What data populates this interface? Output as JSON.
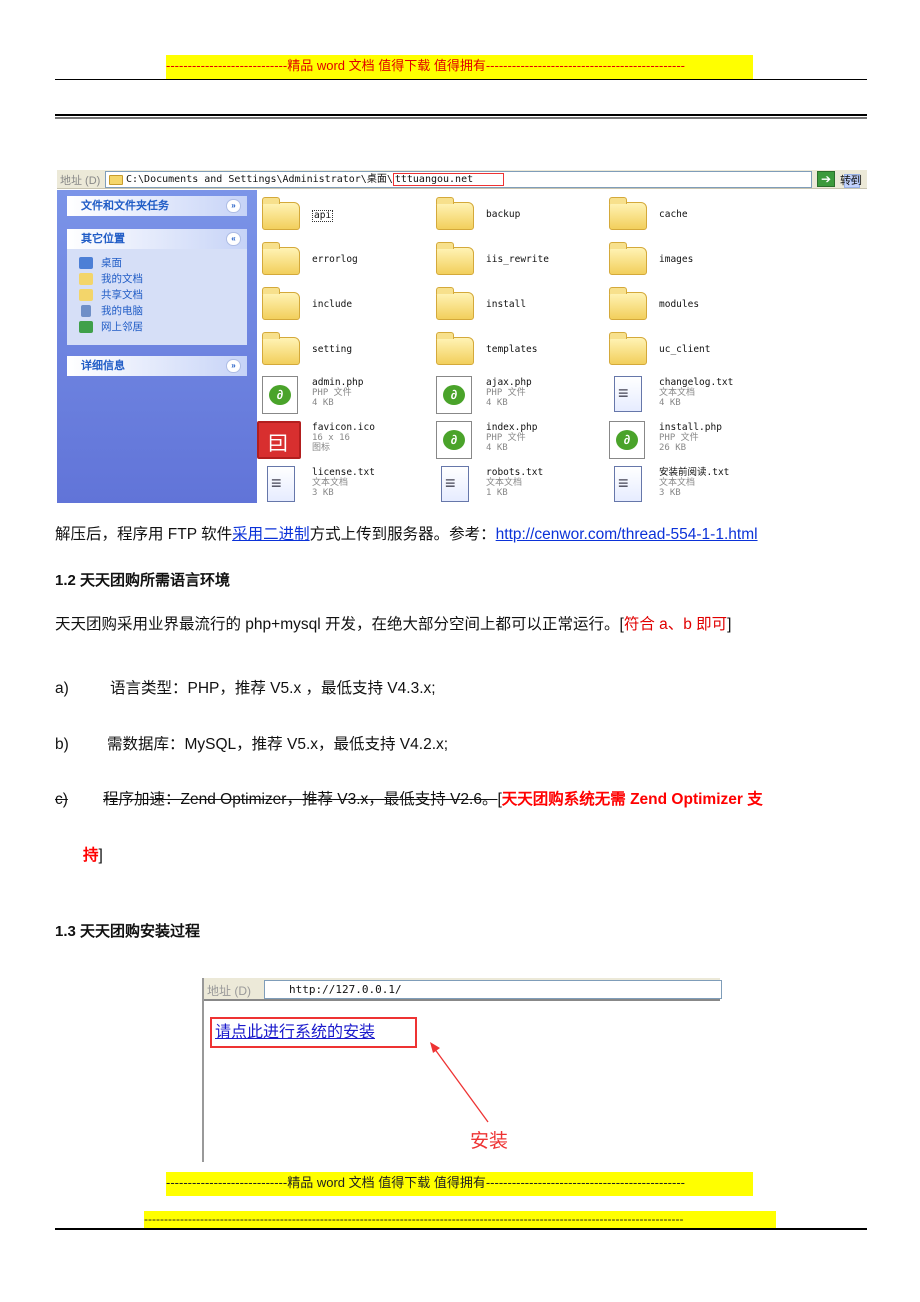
{
  "banners": {
    "top": "----------------------------精品 word 文档 值得下载 值得拥有----------------------------------------------",
    "bottom": "----------------------------精品 word 文档 值得下载 值得拥有----------------------------------------------",
    "dashes": "---------------------------------------------------------------------------------------------------------------------------------------"
  },
  "explorer": {
    "address_label": "地址 (D)",
    "address_path": "C:\\Documents and Settings\\Administrator\\桌面\\",
    "address_highlight": "tttuangou.net",
    "go_label": "转到",
    "sidebar": {
      "panels": [
        {
          "title": "文件和文件夹任务",
          "toggle": "»"
        },
        {
          "title": "其它位置",
          "toggle": "«",
          "items": [
            "桌面",
            "我的文档",
            "共享文档",
            "我的电脑",
            "网上邻居"
          ]
        },
        {
          "title": "详细信息",
          "toggle": "»"
        }
      ]
    },
    "files": [
      {
        "name": "api",
        "type": "folder"
      },
      {
        "name": "backup",
        "type": "folder"
      },
      {
        "name": "cache",
        "type": "folder"
      },
      {
        "name": "errorlog",
        "type": "folder"
      },
      {
        "name": "iis_rewrite",
        "type": "folder"
      },
      {
        "name": "images",
        "type": "folder"
      },
      {
        "name": "include",
        "type": "folder"
      },
      {
        "name": "install",
        "type": "folder"
      },
      {
        "name": "modules",
        "type": "folder"
      },
      {
        "name": "setting",
        "type": "folder"
      },
      {
        "name": "templates",
        "type": "folder"
      },
      {
        "name": "uc_client",
        "type": "folder"
      },
      {
        "name": "admin.php",
        "type": "php",
        "desc": "PHP 文件",
        "size": "4 KB"
      },
      {
        "name": "ajax.php",
        "type": "php",
        "desc": "PHP 文件",
        "size": "4 KB"
      },
      {
        "name": "changelog.txt",
        "type": "txt",
        "desc": "文本文档",
        "size": "4 KB"
      },
      {
        "name": "favicon.ico",
        "type": "ico",
        "desc": "16 x 16",
        "size": "图标"
      },
      {
        "name": "index.php",
        "type": "php",
        "desc": "PHP 文件",
        "size": "4 KB"
      },
      {
        "name": "install.php",
        "type": "php",
        "desc": "PHP 文件",
        "size": "26 KB"
      },
      {
        "name": "license.txt",
        "type": "txt",
        "desc": "文本文档",
        "size": "3 KB"
      },
      {
        "name": "robots.txt",
        "type": "txt",
        "desc": "文本文档",
        "size": "1 KB"
      },
      {
        "name": "安装前阅读.txt",
        "type": "txt",
        "desc": "文本文档",
        "size": "3 KB"
      }
    ]
  },
  "doc": {
    "p1": {
      "pre": "解压后，程序用 FTP 软件",
      "link1": "采用二进制",
      "mid": "方式上传到服务器。参考：",
      "link2": "http://cenwor.com/thread-554-1-1.html"
    },
    "h12": "1.2 天天团购所需语言环境",
    "p2": {
      "text": "天天团购采用业界最流行的 php+mysql 开发，在绝大部分空间上都可以正常运行。[",
      "note": "符合 a、b 即可",
      "close": "]"
    },
    "items": [
      {
        "label": "a)",
        "text": "语言类型：PHP，推荐 V5.x ，最低支持 V4.3.x;"
      },
      {
        "label": "b)",
        "text": "需数据库：MySQL，推荐 V5.x，最低支持 V4.2.x;"
      },
      {
        "label": "c)",
        "text": "程序加速：Zend Optimizer，推荐 V3.x，最低支持 V2.6。",
        "note_open": "[",
        "note": "天天团购系统无需 Zend Optimizer 支",
        "note_cont": "持",
        "note_close": "]"
      }
    ],
    "h13": "1.3  天天团购安装过程"
  },
  "browser2": {
    "address_label": "地址 (D)",
    "url": "http://127.0.0.1/",
    "install_link": "请点此进行系统的安装",
    "callout": "安装"
  }
}
